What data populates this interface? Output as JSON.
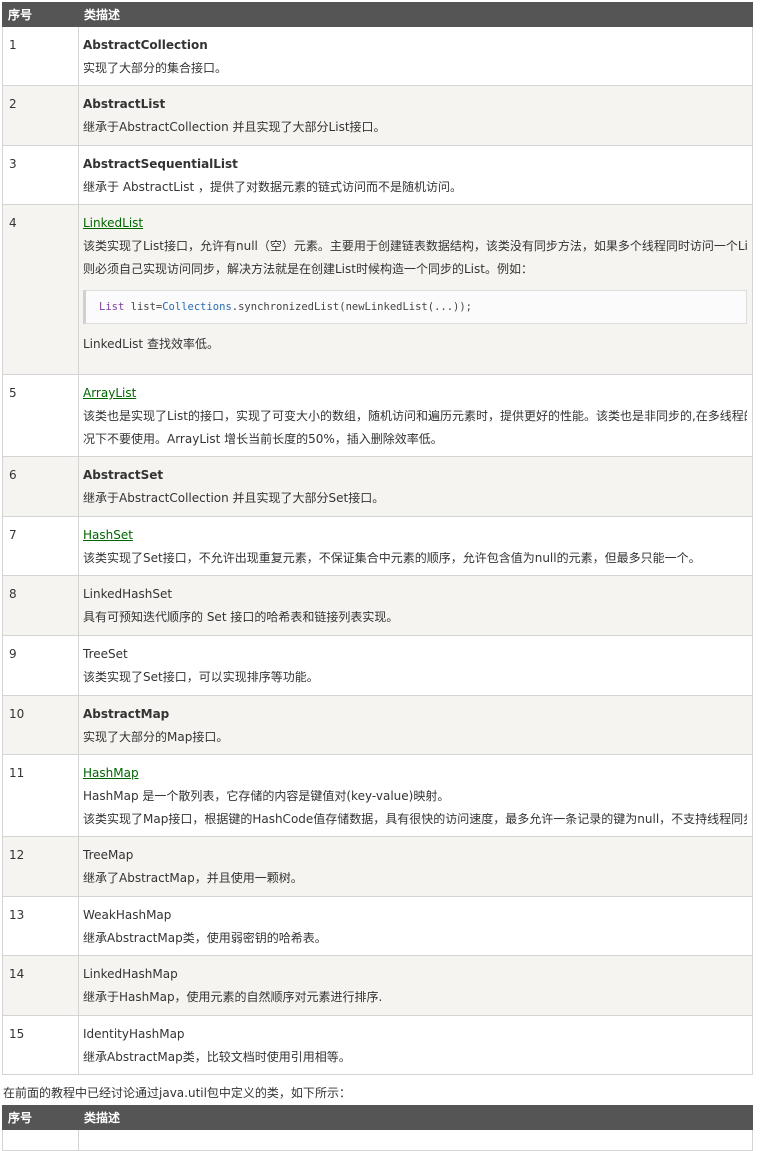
{
  "table1": {
    "headers": {
      "index": "序号",
      "description": "类描述"
    },
    "rows": [
      {
        "num": "1",
        "title": "AbstractCollection",
        "style": "bold",
        "lines": [
          "实现了大部分的集合接口。"
        ]
      },
      {
        "num": "2",
        "title": "AbstractList",
        "style": "bold",
        "lines": [
          "继承于AbstractCollection 并且实现了大部分List接口。"
        ]
      },
      {
        "num": "3",
        "title": "AbstractSequentialList",
        "style": "bold",
        "lines": [
          "继承于 AbstractList ，提供了对数据元素的链式访问而不是随机访问。"
        ]
      },
      {
        "num": "4",
        "title": "LinkedList",
        "style": "link",
        "lines": [
          "该类实现了List接口，允许有null（空）元素。主要用于创建链表数据结构，该类没有同步方法，如果多个线程同时访问一个List，",
          "则必须自己实现访问同步，解决方法就是在创建List时候构造一个同步的List。例如："
        ],
        "code": {
          "kw": "List",
          "var": " list=",
          "cls": "Collections",
          "rest": ".synchronizedList(newLinkedList(...));"
        },
        "after": "LinkedList 查找效率低。"
      },
      {
        "num": "5",
        "title": "ArrayList",
        "style": "link",
        "lines": [
          "该类也是实现了List的接口，实现了可变大小的数组，随机访问和遍历元素时，提供更好的性能。该类也是非同步的,在多线程的情",
          "况下不要使用。ArrayList 增长当前长度的50%，插入删除效率低。"
        ]
      },
      {
        "num": "6",
        "title": "AbstractSet",
        "style": "bold",
        "lines": [
          "继承于AbstractCollection 并且实现了大部分Set接口。"
        ]
      },
      {
        "num": "7",
        "title": "HashSet",
        "style": "link",
        "lines": [
          "该类实现了Set接口，不允许出现重复元素，不保证集合中元素的顺序，允许包含值为null的元素，但最多只能一个。"
        ]
      },
      {
        "num": "8",
        "title": "LinkedHashSet",
        "style": "plain",
        "lines": [
          "具有可预知迭代顺序的 Set 接口的哈希表和链接列表实现。"
        ]
      },
      {
        "num": "9",
        "title": "TreeSet",
        "style": "plain",
        "lines": [
          "该类实现了Set接口，可以实现排序等功能。"
        ]
      },
      {
        "num": "10",
        "title": "AbstractMap",
        "style": "bold",
        "lines": [
          "实现了大部分的Map接口。"
        ]
      },
      {
        "num": "11",
        "title": "HashMap",
        "style": "link",
        "lines": [
          "HashMap 是一个散列表，它存储的内容是键值对(key-value)映射。",
          "该类实现了Map接口，根据键的HashCode值存储数据，具有很快的访问速度，最多允许一条记录的键为null，不支持线程同步。"
        ]
      },
      {
        "num": "12",
        "title": "TreeMap",
        "style": "plain",
        "lines": [
          "继承了AbstractMap，并且使用一颗树。"
        ]
      },
      {
        "num": "13",
        "title": "WeakHashMap",
        "style": "plain",
        "lines": [
          "继承AbstractMap类，使用弱密钥的哈希表。"
        ]
      },
      {
        "num": "14",
        "title": "LinkedHashMap",
        "style": "plain",
        "lines": [
          "继承于HashMap，使用元素的自然顺序对元素进行排序."
        ]
      },
      {
        "num": "15",
        "title": "IdentityHashMap",
        "style": "plain",
        "lines": [
          "继承AbstractMap类，比较文档时使用引用相等。"
        ]
      }
    ]
  },
  "between_text": "在前面的教程中已经讨论通过java.util包中定义的类，如下所示：",
  "table2": {
    "headers": {
      "index": "序号",
      "description": "类描述"
    }
  }
}
